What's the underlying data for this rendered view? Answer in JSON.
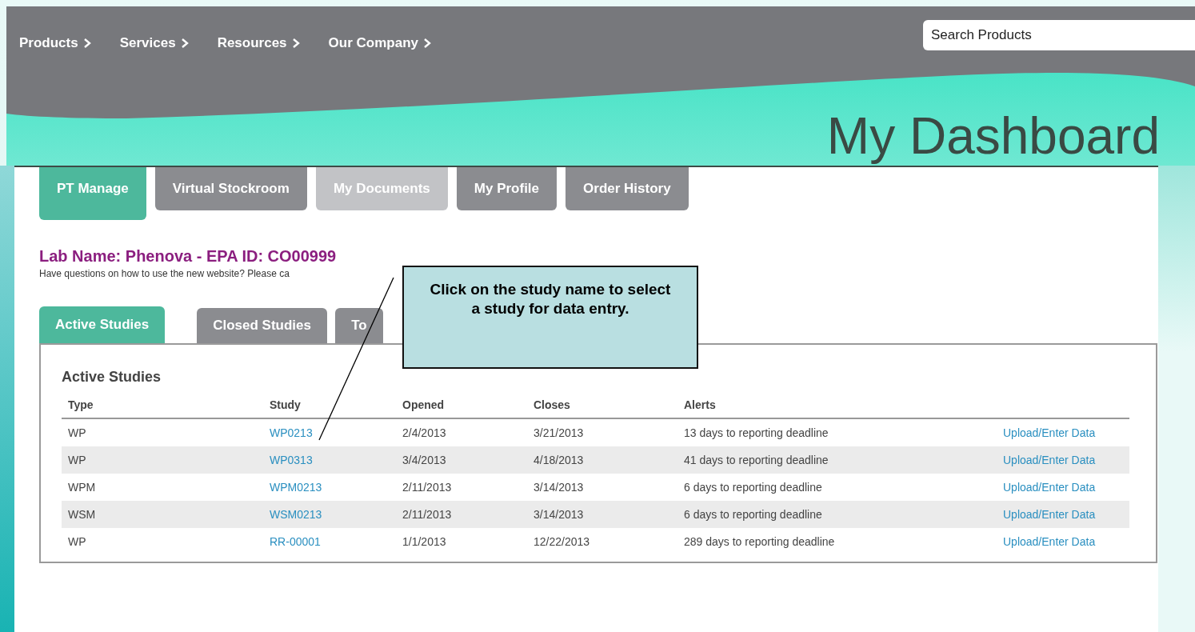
{
  "nav": [
    {
      "label": "Products"
    },
    {
      "label": "Services"
    },
    {
      "label": "Resources"
    },
    {
      "label": "Our Company"
    }
  ],
  "search": {
    "placeholder": "Search Products"
  },
  "page_title": "My Dashboard",
  "main_tabs": [
    {
      "label": "PT Manage",
      "selected": true,
      "disabled": false
    },
    {
      "label": "Virtual Stockroom",
      "selected": false,
      "disabled": false
    },
    {
      "label": "My Documents",
      "selected": false,
      "disabled": true
    },
    {
      "label": "My Profile",
      "selected": false,
      "disabled": false
    },
    {
      "label": "Order History",
      "selected": false,
      "disabled": false
    }
  ],
  "lab_heading": "Lab Name: Phenova - EPA ID: CO00999",
  "help_text": "Have questions on how to use the new website? Please ca",
  "study_tabs": [
    {
      "label": "Active Studies",
      "selected": true
    },
    {
      "label": "Closed Studies",
      "selected": false
    },
    {
      "label": "To",
      "selected": false
    }
  ],
  "callout": "Click on the study name to select a study for data entry.",
  "table": {
    "title": "Active Studies",
    "columns": [
      "Type",
      "Study",
      "Opened",
      "Closes",
      "Alerts"
    ],
    "rows": [
      {
        "type": "WP",
        "study": "WP0213",
        "opened": "2/4/2013",
        "closes": "3/21/2013",
        "alert": "13 days to reporting deadline",
        "action": "Upload/Enter Data"
      },
      {
        "type": "WP",
        "study": "WP0313",
        "opened": "3/4/2013",
        "closes": "4/18/2013",
        "alert": "41 days to reporting deadline",
        "action": "Upload/Enter Data"
      },
      {
        "type": "WPM",
        "study": "WPM0213",
        "opened": "2/11/2013",
        "closes": "3/14/2013",
        "alert": "6 days to reporting deadline",
        "action": "Upload/Enter Data"
      },
      {
        "type": "WSM",
        "study": "WSM0213",
        "opened": "2/11/2013",
        "closes": "3/14/2013",
        "alert": "6 days to reporting deadline",
        "action": "Upload/Enter Data"
      },
      {
        "type": "WP",
        "study": "RR-00001",
        "opened": "1/1/2013",
        "closes": "12/22/2013",
        "alert": "289 days to reporting deadline",
        "action": "Upload/Enter Data"
      }
    ]
  }
}
